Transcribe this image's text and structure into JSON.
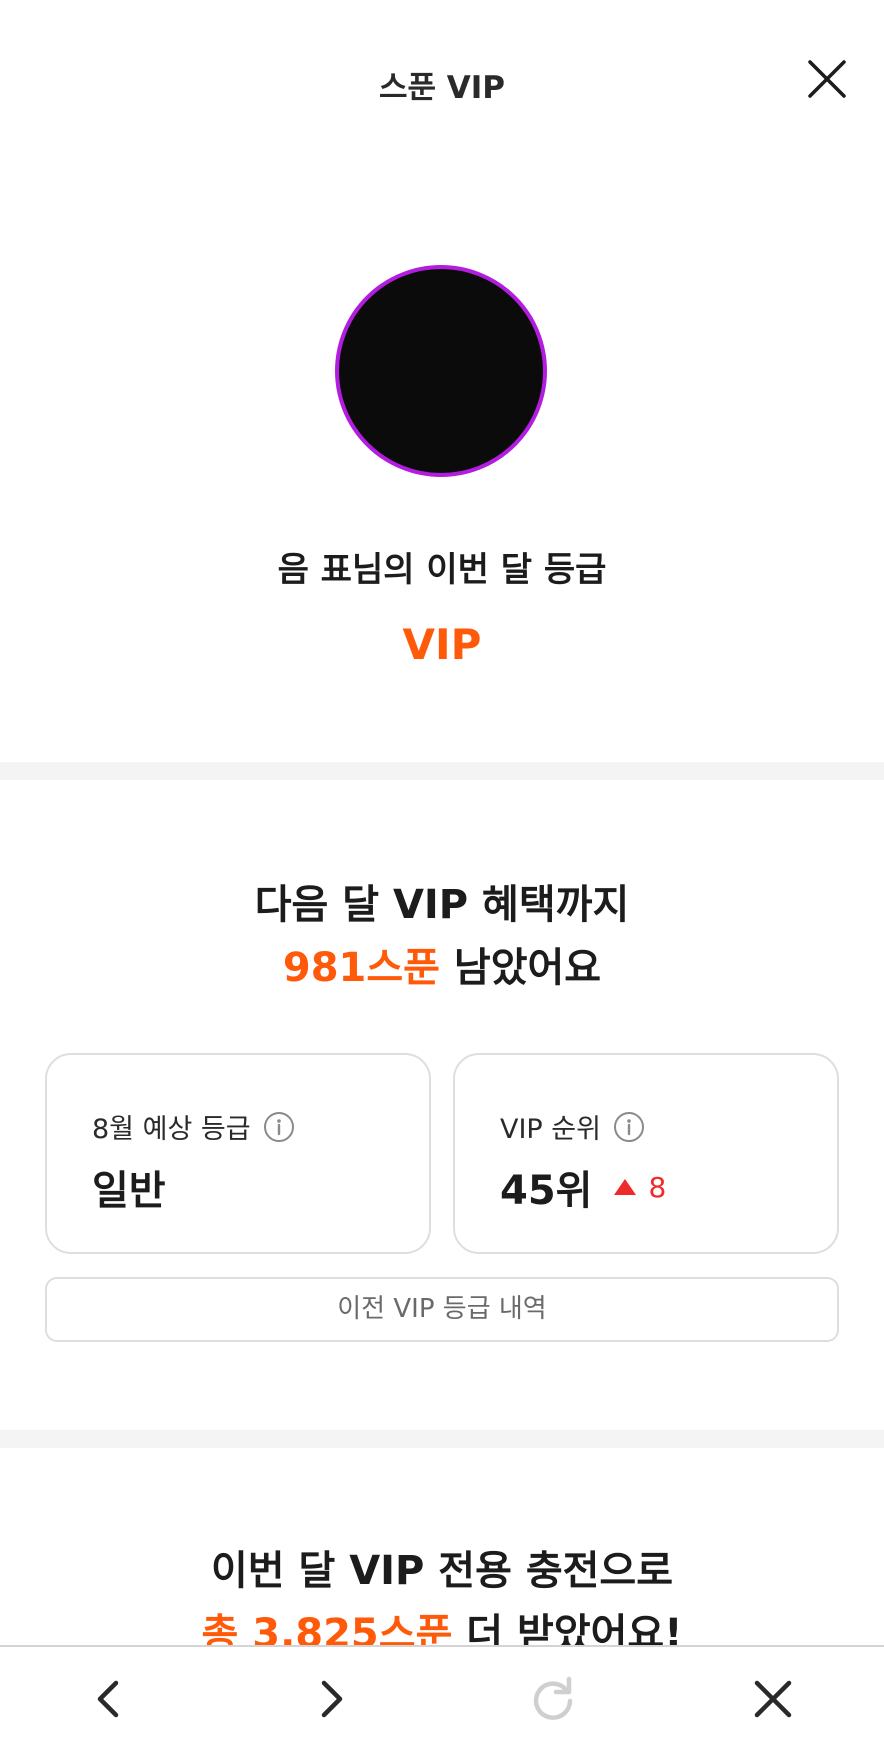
{
  "header": {
    "title": "스푼 VIP"
  },
  "profile": {
    "grade_caption": "음 표님의 이번 달 등급",
    "grade_value": "VIP"
  },
  "next_benefit": {
    "line1": "다음 달 VIP 혜택까지",
    "amount": "981스푼",
    "suffix": " 남았어요"
  },
  "cards": {
    "expected": {
      "label": "8월 예상 등급",
      "value": "일반"
    },
    "rank": {
      "label": "VIP 순위",
      "value": "45위",
      "change": "8"
    }
  },
  "history_button": "이전 VIP 등급 내역",
  "charge": {
    "line1": "이번 달 VIP 전용 충전으로",
    "amount": "총 3,825스푼",
    "suffix": " 더 받았어요!"
  },
  "colors": {
    "accent": "#ff5a0a",
    "avatar_ring": "#b31de0",
    "rank_up": "#ee2a2a",
    "disabled_icon": "#cfcfcf"
  },
  "icons": {
    "close": "close-icon",
    "info": "info-icon",
    "back": "chevron-left-icon",
    "forward": "chevron-right-icon",
    "refresh": "refresh-icon",
    "bottom_close": "close-icon"
  }
}
